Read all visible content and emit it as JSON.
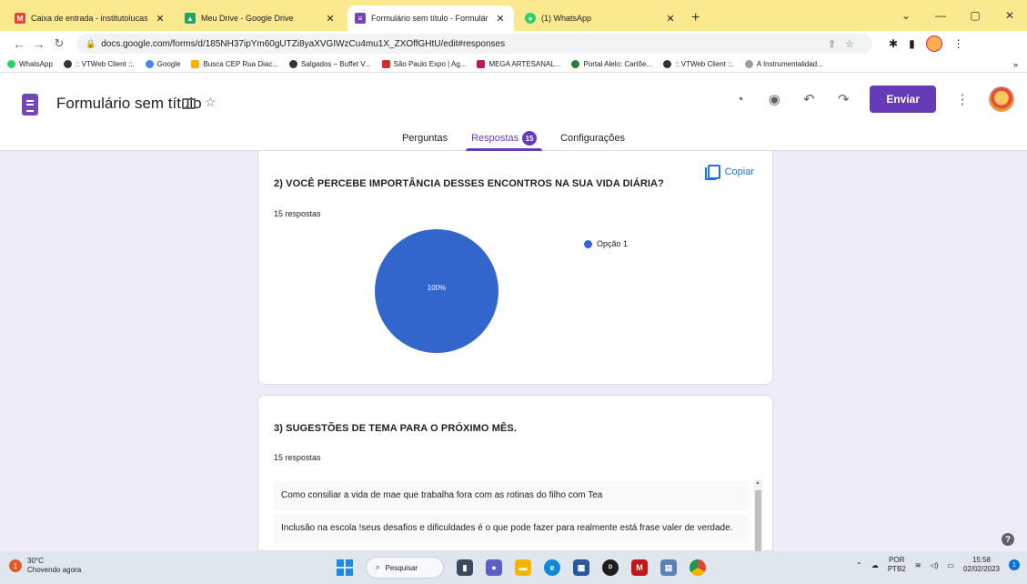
{
  "browser": {
    "tabs": [
      {
        "title": "Caixa de entrada - institutolucas",
        "favicon": "gmail-icon",
        "active": false
      },
      {
        "title": "Meu Drive - Google Drive",
        "favicon": "drive-icon",
        "active": false
      },
      {
        "title": "Formulário sem título - Formulár",
        "favicon": "forms-icon",
        "active": true
      },
      {
        "title": "(1) WhatsApp",
        "favicon": "whatsapp-icon",
        "active": false
      }
    ],
    "url": "docs.google.com/forms/d/185NH37ipYm60gUTZi8yaXVGIWzCu4mu1X_ZXOffGHtU/edit#responses",
    "bookmarks": [
      {
        "label": "WhatsApp",
        "color": "#25d366"
      },
      {
        "label": ":: VTWeb Client ::.",
        "color": "#333333"
      },
      {
        "label": "Google",
        "color": "#4285f4"
      },
      {
        "label": "Busca CEP Rua Diac...",
        "color": "#f4b400"
      },
      {
        "label": "Salgados – Buffet V...",
        "color": "#333333"
      },
      {
        "label": "São Paulo Expo | Ag...",
        "color": "#d32f2f"
      },
      {
        "label": "MEGA ARTESANAL...",
        "color": "#c2185b"
      },
      {
        "label": "Portal Alelo: Cartõe...",
        "color": "#2e7d32"
      },
      {
        "label": ":: VTWeb Client ::.",
        "color": "#333333"
      },
      {
        "label": "A Instrumentalidad...",
        "color": "#9e9e9e"
      }
    ]
  },
  "form": {
    "title": "Formulário sem título",
    "send_label": "Enviar",
    "tabs": [
      {
        "label": "Perguntas",
        "active": false
      },
      {
        "label": "Respostas",
        "active": true,
        "badge": "15"
      },
      {
        "label": "Configurações",
        "active": false
      }
    ]
  },
  "questions": [
    {
      "title": "2) VOCÊ PERCEBE IMPORTÂNCIA DESSES ENCONTROS NA SUA VIDA DIÁRIA?",
      "count": "15 respostas",
      "copy_label": "Copiar"
    },
    {
      "title": "3) SUGESTÕES DE TEMA PARA O PRÓXIMO MÊS.",
      "count": "15 respostas",
      "responses": [
        "Como consiliar a vida de mae que trabalha fora com as rotinas do filho com Tea",
        "Inclusão na escola !seus desafios e dificuldades é o que pode fazer para realmente está frase valer de verdade."
      ]
    }
  ],
  "chart_data": {
    "type": "pie",
    "slices": [
      {
        "label": "Opção 1",
        "value": 100,
        "display": "100%",
        "color": "#3366cc"
      }
    ]
  },
  "taskbar": {
    "temperature": "30°C",
    "weather_desc": "Chovendo agora",
    "search_label": "Pesquisar",
    "lang_top": "POR",
    "lang_bottom": "PTB2",
    "time": "15:58",
    "date": "02/02/2023",
    "notification_count": "1",
    "weather_badge": "1"
  }
}
